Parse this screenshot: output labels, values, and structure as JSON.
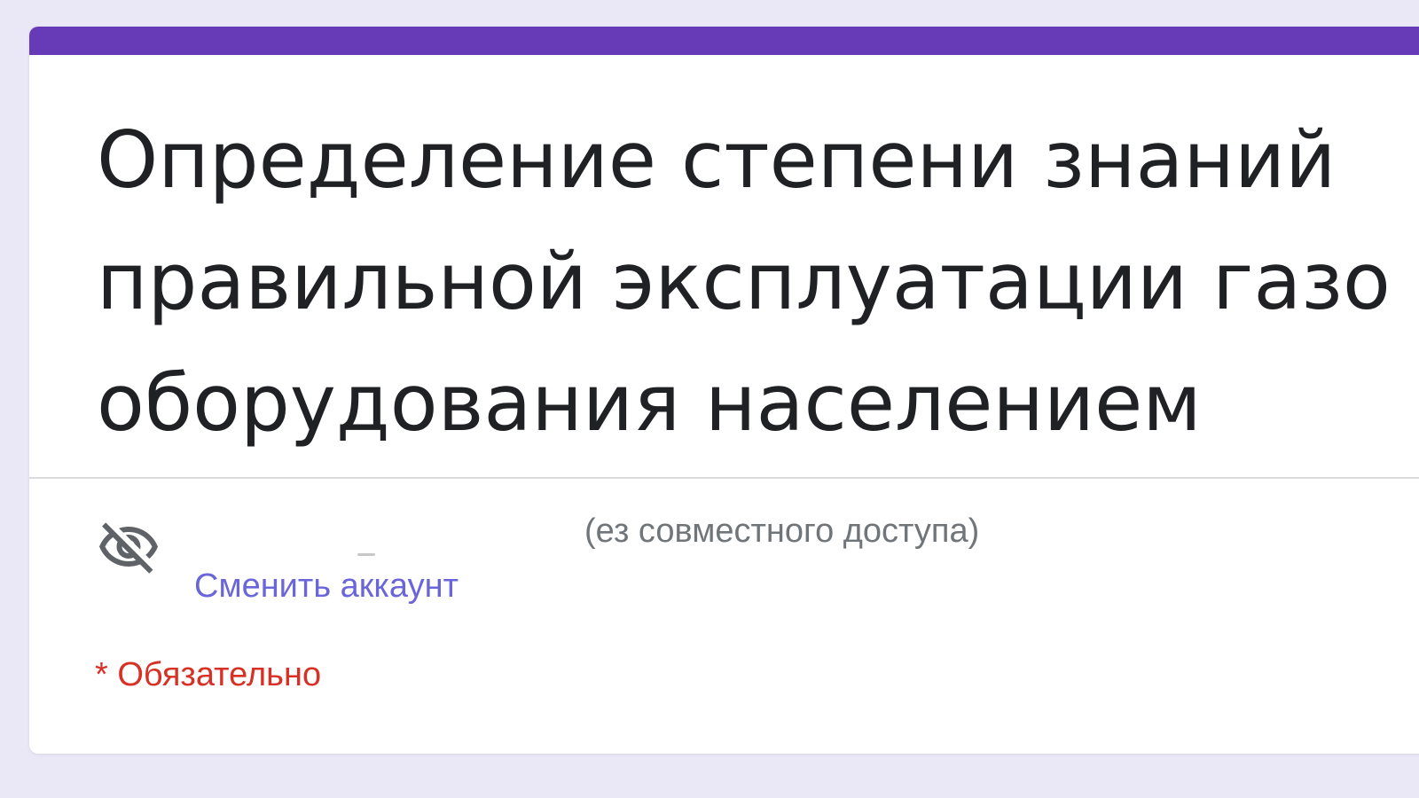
{
  "form": {
    "title_lines": [
      "Определение степени знаний",
      "правильной эксплуатации газо",
      "оборудования населением"
    ],
    "account": {
      "status_text": "(ез совместного доступа)",
      "switch_label": "Сменить аккаунт",
      "visibility_icon": "eye-off-icon"
    },
    "required_label": "* Обязательно"
  },
  "colors": {
    "accent": "#673ab7",
    "background": "#eae7f7",
    "link": "#6a66d9",
    "required": "#d93025"
  }
}
